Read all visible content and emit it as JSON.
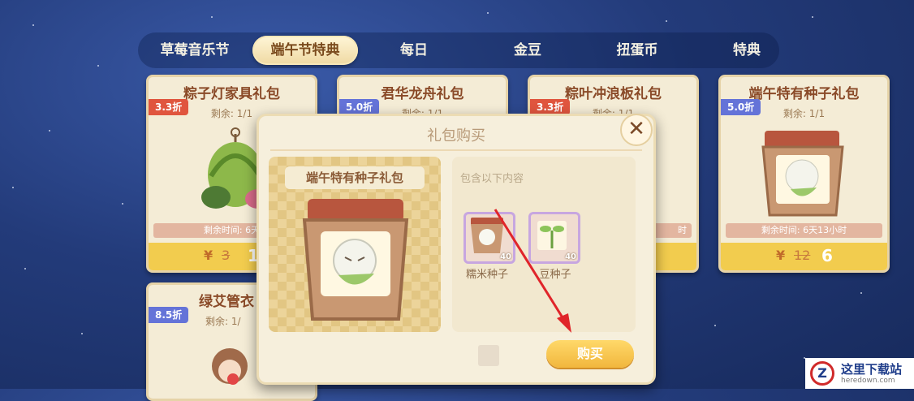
{
  "tabs": [
    {
      "label": "草莓音乐节",
      "active": false
    },
    {
      "label": "端午节特典",
      "active": true
    },
    {
      "label": "每日",
      "active": false
    },
    {
      "label": "金豆",
      "active": false
    },
    {
      "label": "扭蛋币",
      "active": false
    },
    {
      "label": "特典",
      "active": false
    }
  ],
  "cards": [
    {
      "title": "粽子灯家具礼包",
      "discount": "3.3折",
      "discount_color": "red",
      "remain": "剩余: 1/1",
      "timer": "剩余时间: 6天",
      "currency": "¥",
      "old_price": "3",
      "price": "1"
    },
    {
      "title": "君华龙舟礼包",
      "discount": "5.0折",
      "discount_color": "blue",
      "remain": "剩余: 1/1"
    },
    {
      "title": "粽叶冲浪板礼包",
      "discount": "3.3折",
      "discount_color": "red",
      "remain": "剩余: 1/1",
      "timer": "时"
    },
    {
      "title": "端午特有种子礼包",
      "discount": "5.0折",
      "discount_color": "blue",
      "remain": "剩余: 1/1",
      "timer": "剩余时间: 6天13小时",
      "currency": "¥",
      "old_price": "12",
      "price": "6"
    },
    {
      "title": "绿艾管衣",
      "discount": "8.5折",
      "discount_color": "blue",
      "remain": "剩余: 1/"
    }
  ],
  "modal": {
    "title": "礼包购买",
    "close_label": "✕",
    "pack_name": "端午特有种子礼包",
    "contents_label": "包含以下内容",
    "items": [
      {
        "name": "糯米种子",
        "count": "40"
      },
      {
        "name": "豆种子",
        "count": "40"
      }
    ],
    "buy_label": "购买"
  },
  "watermark": {
    "title": "这里下载站",
    "url": "heredown.com",
    "logo_letter": "Z"
  },
  "colors": {
    "accent": "#f2cc4e",
    "discount_red": "#e0553e",
    "discount_blue": "#6473d8",
    "arrow": "#e0252a"
  }
}
